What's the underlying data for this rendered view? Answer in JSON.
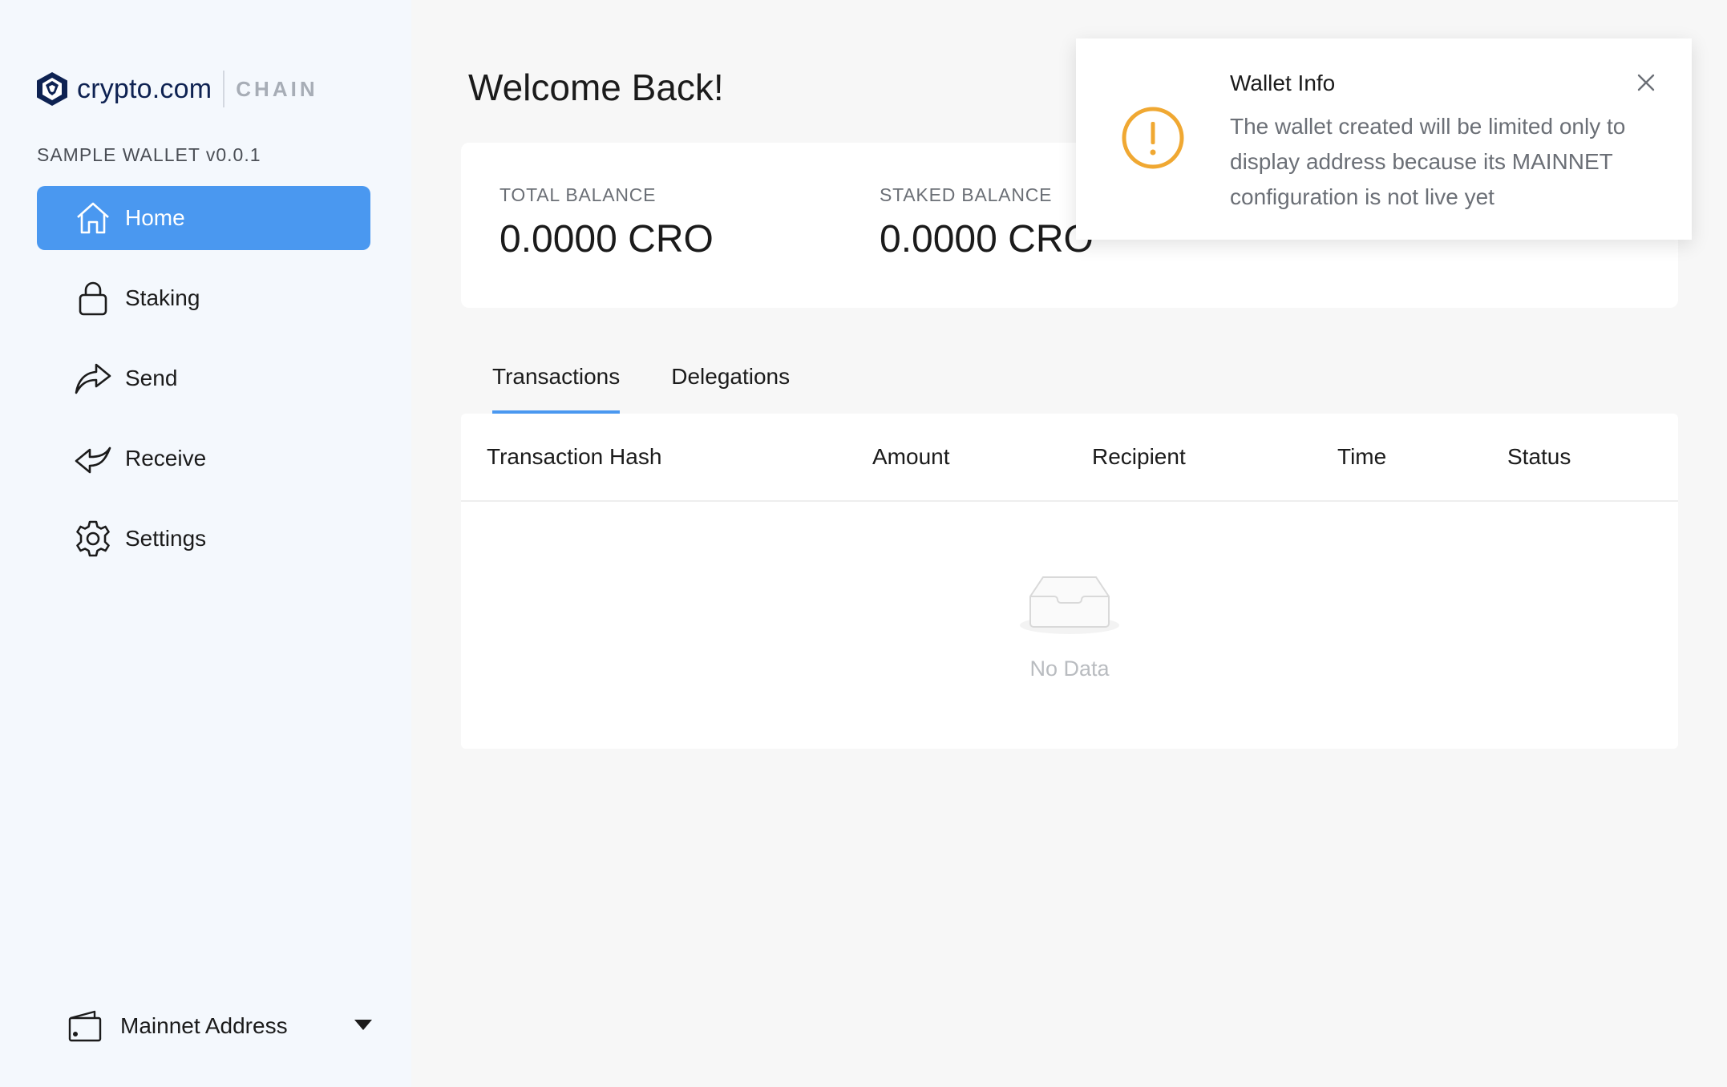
{
  "brand": {
    "name": "crypto.com",
    "product": "CHAIN",
    "wallet_version": "SAMPLE WALLET v0.0.1",
    "primary_color": "#4a98f0",
    "logo_color": "#0e2252"
  },
  "sidebar": {
    "items": [
      {
        "label": "Home",
        "icon": "home-icon",
        "active": true
      },
      {
        "label": "Staking",
        "icon": "lock-icon",
        "active": false
      },
      {
        "label": "Send",
        "icon": "send-arrow-icon",
        "active": false
      },
      {
        "label": "Receive",
        "icon": "receive-arrow-icon",
        "active": false
      },
      {
        "label": "Settings",
        "icon": "gear-icon",
        "active": false
      }
    ],
    "address_selector": {
      "label": "Mainnet Address",
      "icon": "wallet-icon"
    }
  },
  "main": {
    "title": "Welcome Back!",
    "balances": [
      {
        "label": "TOTAL BALANCE",
        "value": "0.0000 CRO"
      },
      {
        "label": "STAKED BALANCE",
        "value": "0.0000 CRO"
      }
    ],
    "tabs": [
      {
        "label": "Transactions",
        "active": true
      },
      {
        "label": "Delegations",
        "active": false
      }
    ],
    "table": {
      "columns": [
        "Transaction Hash",
        "Amount",
        "Recipient",
        "Time",
        "Status"
      ],
      "rows": [],
      "empty_text": "No Data"
    }
  },
  "notification": {
    "title": "Wallet Info",
    "body": "The wallet created will be limited only to display address because its MAINNET configuration is not live yet",
    "icon": "warning-icon",
    "icon_color": "#f0a832"
  }
}
